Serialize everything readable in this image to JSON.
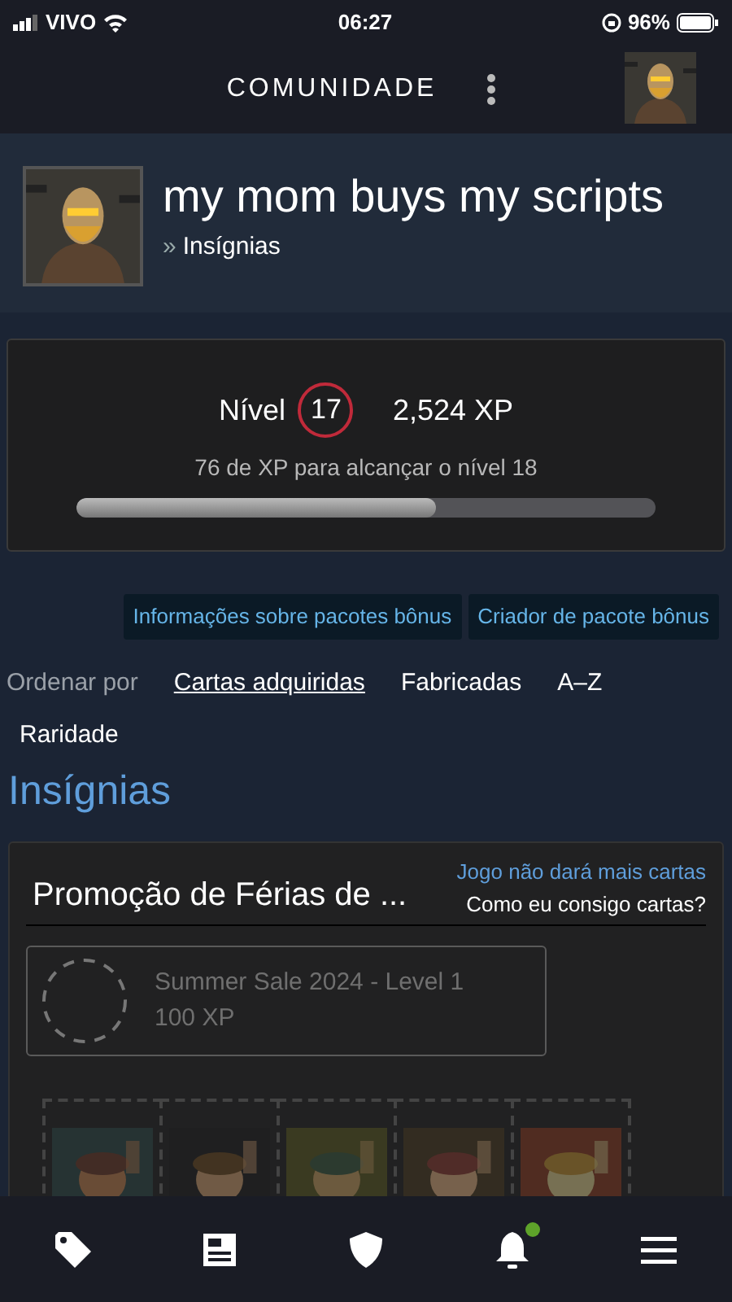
{
  "status_bar": {
    "carrier": "VIVO",
    "time": "06:27",
    "battery": "96%"
  },
  "header": {
    "title": "COMUNIDADE"
  },
  "profile": {
    "name": "my mom buys my scripts",
    "breadcrumb_mark": "»",
    "breadcrumb": "Insígnias"
  },
  "level_card": {
    "label": "Nível",
    "level_number": "17",
    "xp": "2,524 XP",
    "hint": "76 de XP para alcançar o nível 18",
    "level": 0.62
  },
  "buttons": [
    "Informações sobre pacotes bônus",
    "Criador de pacote bônus"
  ],
  "sort": {
    "label": "Ordenar por",
    "options": [
      {
        "label": "Cartas adquiridas",
        "selected": true
      },
      {
        "label": "Fabricadas",
        "selected": false
      },
      {
        "label": "A–Z",
        "selected": false
      },
      {
        "label": "Raridade",
        "selected": false
      }
    ]
  },
  "section_title": "Insígnias",
  "badge": {
    "title": "Promoção de Férias de ...",
    "note": "Jogo não dará mais cartas",
    "help": "Como eu consigo cartas?",
    "item_name": "Summer Sale 2024 - Level 1",
    "item_xp": "100 XP"
  },
  "nav": [
    {
      "kind": "tag",
      "notification": false
    },
    {
      "kind": "news",
      "notification": false
    },
    {
      "kind": "shield",
      "notification": false
    },
    {
      "kind": "bell",
      "notification": true
    },
    {
      "kind": "menu",
      "notification": false
    }
  ]
}
